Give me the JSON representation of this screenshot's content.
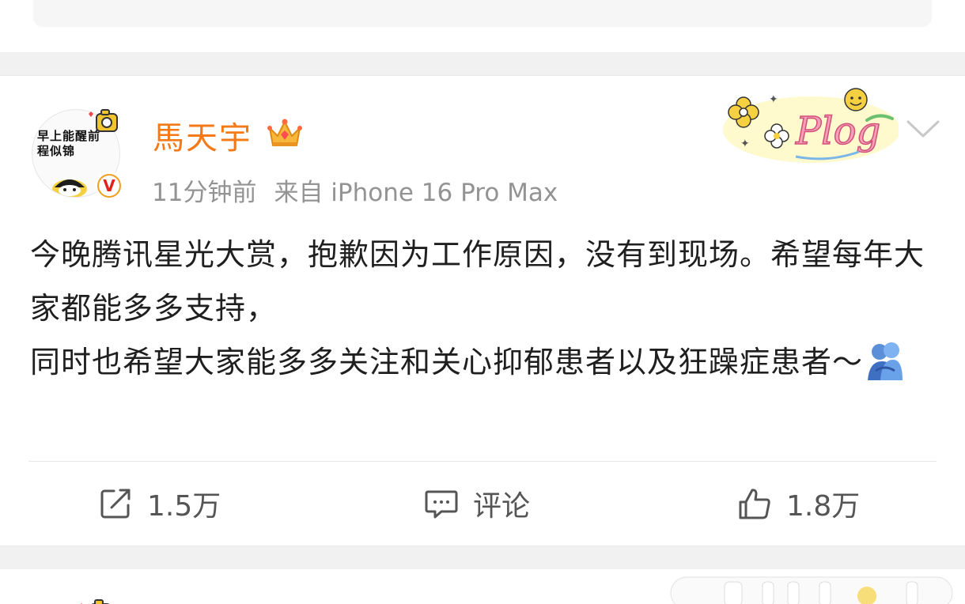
{
  "post": {
    "username": "馬天宇",
    "time": "11分钟前",
    "source": "来自 iPhone 16 Pro Max",
    "avatar_text": "早上能醒前程似锦",
    "content_lines": [
      "今晚腾讯星光大赏，抱歉因为工作原因，没有到现场。希望每年大家都能多多支持，",
      "同时也希望大家能多多关注和关心抑郁患者以及狂躁症患者～"
    ],
    "decoration_text": "Plog",
    "verified_badge": "V",
    "icons": {
      "crown": "crown-icon",
      "verified": "verified-icon",
      "chevron": "chevron-down-icon",
      "repost": "repost-icon",
      "comment": "comment-icon",
      "like": "thumbs-up-icon",
      "emoji": "people-hugging-emoji"
    }
  },
  "actions": {
    "repost_count": "1.5万",
    "comment_label": "评论",
    "like_count": "1.8万"
  },
  "colors": {
    "username": "#f47a18",
    "meta": "#939393",
    "text": "#1f1f1f",
    "background_gap": "#f1f1f1",
    "verified_ring": "#f0a020",
    "verified_v": "#e0231b"
  }
}
